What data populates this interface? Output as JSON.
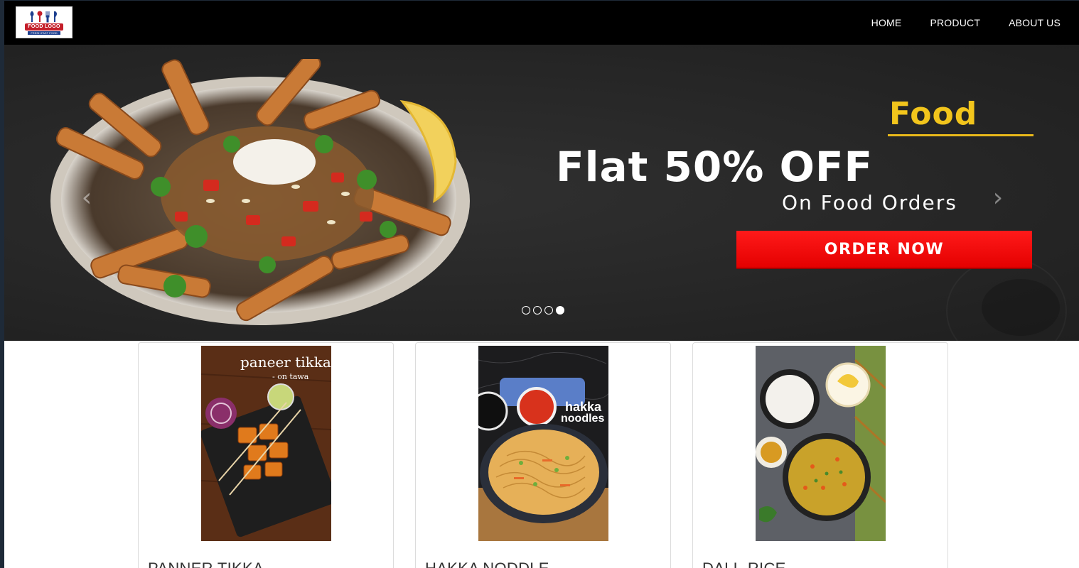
{
  "navbar": {
    "logo": {
      "badge_text": "FOOD LOGO",
      "tagline": "FRESH FAST FOOD"
    },
    "links": [
      "HOME",
      "PRODUCT",
      "ABOUT US"
    ]
  },
  "carousel": {
    "heading": "Food",
    "offer": "Flat 50% OFF",
    "subtext": "On Food Orders",
    "cta": "ORDER NOW",
    "prev_icon": "chevron-left-icon",
    "next_icon": "chevron-right-icon",
    "slide_count": 4,
    "active_slide": 4
  },
  "products": [
    {
      "title": "PANNER TIKKA",
      "image_caption": "paneer tikka",
      "image_caption_sub": "- on tawa"
    },
    {
      "title": "HAKKA NODDLE",
      "image_caption_line1": "hakka",
      "image_caption_line2": "noodles"
    },
    {
      "title": "DALL-RICE"
    }
  ],
  "colors": {
    "navbar_bg": "#000000",
    "promo_yellow": "#f2c51c",
    "cta_red": "#e40000",
    "carousel_bg": "#262626"
  }
}
